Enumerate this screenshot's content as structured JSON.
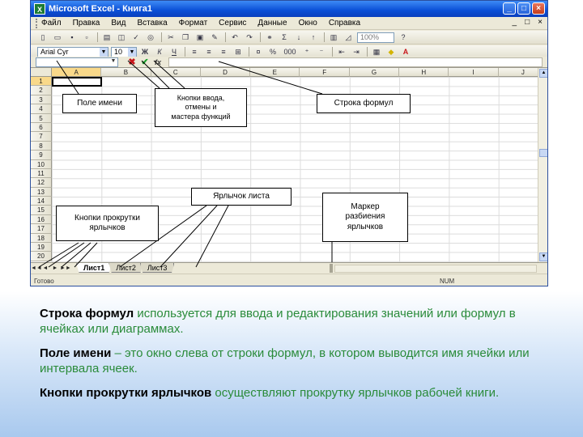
{
  "window": {
    "title": "Microsoft Excel - Книга1",
    "icon_label": "X",
    "controls": [
      "_",
      "□",
      "×"
    ],
    "doc_controls": [
      "_",
      "□",
      "×"
    ]
  },
  "menu": {
    "items": [
      "Файл",
      "Правка",
      "Вид",
      "Вставка",
      "Формат",
      "Сервис",
      "Данные",
      "Окно",
      "Справка"
    ]
  },
  "toolbar_standard": {
    "zoom": "100%"
  },
  "toolbar_format": {
    "font": "Arial Cyr",
    "size": "10",
    "bold": "Ж",
    "italic": "К",
    "underline": "Ч",
    "num_format": "000",
    "percent": "%"
  },
  "formula_bar": {
    "cancel": "✖",
    "enter": "✔",
    "function": "fx"
  },
  "grid": {
    "columns": [
      "A",
      "B",
      "C",
      "D",
      "E",
      "F",
      "G",
      "H",
      "I",
      "J"
    ],
    "rows": [
      "1",
      "2",
      "3",
      "4",
      "5",
      "6",
      "7",
      "8",
      "9",
      "10",
      "11",
      "12",
      "13",
      "14",
      "15",
      "16",
      "17",
      "18",
      "19",
      "20",
      "21"
    ],
    "selected_column": "A",
    "selected_row": "1"
  },
  "sheets": {
    "tabs": [
      "Лист1",
      "Лист2",
      "Лист3"
    ],
    "active": "Лист1",
    "nav": [
      "◄◄",
      "◄",
      "►",
      "►►"
    ]
  },
  "status": {
    "ready": "Готово",
    "num": "NUM"
  },
  "callouts": {
    "name_box": "Поле имени",
    "entry_buttons": [
      "Кнопки ввода,",
      "отмены и",
      "мастера функций"
    ],
    "formula_bar": "Строка формул",
    "sheet_tab": "Ярлычок листа",
    "scroll_buttons": [
      "Кнопки прокрутки",
      "ярлычков"
    ],
    "split_marker": [
      "Маркер",
      "разбиения",
      "ярлычков"
    ]
  },
  "explanations": [
    {
      "term": "Строка формул",
      "text": " используется для ввода и редактирования значений или формул в ячейках или диаграммах."
    },
    {
      "term": "Поле имени",
      "text": " – это окно слева от строки формул, в котором выводится имя ячейки или интервала ячеек."
    },
    {
      "term": "Кнопки прокрутки ярлычков",
      "text": " осуществляют прокрутку ярлычков рабочей книги."
    }
  ],
  "colors": {
    "term": "#000000",
    "text": "#2a8b3a",
    "titlebar": "#0a4fd6"
  }
}
